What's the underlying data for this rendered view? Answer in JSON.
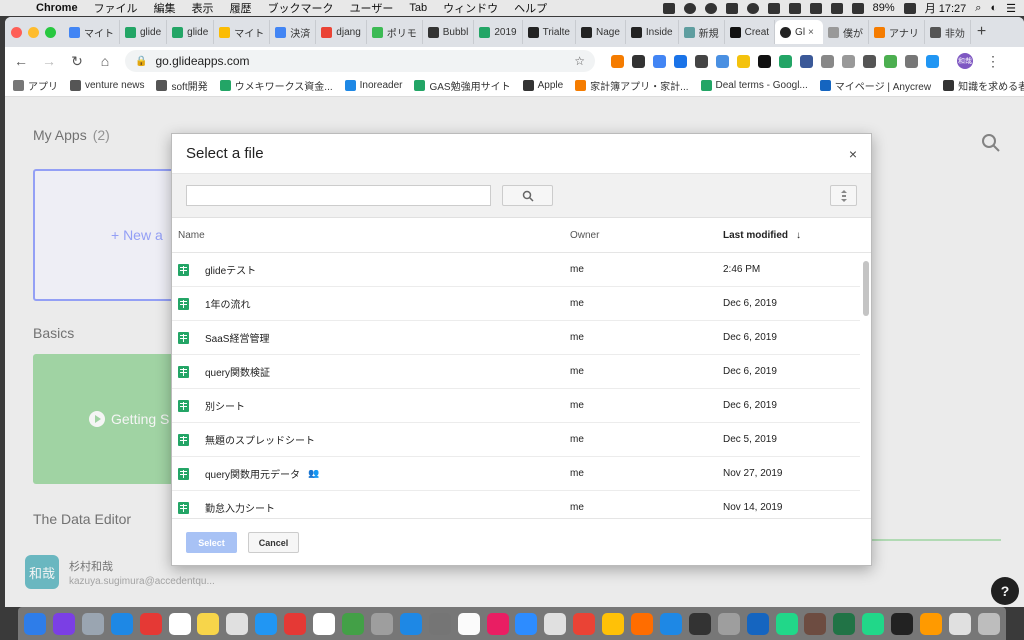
{
  "menubar": {
    "app_name": "Chrome",
    "items": [
      "ファイル",
      "編集",
      "表示",
      "履歴",
      "ブックマーク",
      "ユーザー",
      "Tab",
      "ウィンドウ",
      "ヘルプ"
    ],
    "battery": "89%",
    "clock": "月 17:27"
  },
  "tabs": [
    {
      "label": "マイト",
      "color": "#4285f4"
    },
    {
      "label": "glide",
      "color": "#23a566"
    },
    {
      "label": "glide",
      "color": "#23a566"
    },
    {
      "label": "マイト",
      "color": "#fbbc04"
    },
    {
      "label": "決済",
      "color": "#4285f4"
    },
    {
      "label": "djang",
      "color": "#ea4335"
    },
    {
      "label": "ポリモ",
      "color": "#3cba54"
    },
    {
      "label": "Bubbl",
      "color": "#333333"
    },
    {
      "label": "2019",
      "color": "#23a566"
    },
    {
      "label": "Trialte",
      "color": "#222222"
    },
    {
      "label": "Nage",
      "color": "#222222"
    },
    {
      "label": "Inside",
      "color": "#222222"
    },
    {
      "label": "新規",
      "color": "#5f9ea0"
    },
    {
      "label": "Creat",
      "color": "#111111"
    }
  ],
  "active_tab": {
    "label": "Gl",
    "close": "×"
  },
  "tabs_after": [
    {
      "label": "僕が",
      "color": "#999999"
    },
    {
      "label": "アナリ",
      "color": "#f57c00"
    },
    {
      "label": "非効",
      "color": "#555555"
    }
  ],
  "new_tab_label": "+",
  "address": {
    "url": "go.glideapps.com"
  },
  "profile_initials": "和哉",
  "extensions": [
    "#f57c00",
    "#333333",
    "#4285f4",
    "#1a73e8",
    "#444444",
    "#4a90e2",
    "#f4c20d",
    "#111111",
    "#23a566",
    "#3b5998",
    "#888888",
    "#999999",
    "#555555",
    "#4caf50",
    "#777777",
    "#2196f3"
  ],
  "bookmarks": [
    {
      "label": "アプリ",
      "color": "#777777"
    },
    {
      "label": "venture news",
      "color": "#555555"
    },
    {
      "label": "soft開発",
      "color": "#555555"
    },
    {
      "label": "ウメキワークス資金...",
      "color": "#23a566"
    },
    {
      "label": "Inoreader",
      "color": "#1e88e5"
    },
    {
      "label": "GAS勉強用サイト",
      "color": "#23a566"
    },
    {
      "label": "Apple",
      "color": "#333333"
    },
    {
      "label": "家計簿アプリ・家計...",
      "color": "#f57c00"
    },
    {
      "label": "Deal terms - Googl...",
      "color": "#23a566"
    },
    {
      "label": "マイページ | Anycrew",
      "color": "#1565c0"
    },
    {
      "label": "知識を求める者",
      "color": "#333333"
    }
  ],
  "bookmarks_more": "»",
  "page": {
    "my_apps_label": "My Apps",
    "my_apps_count": "(2)",
    "new_app_label": "+ New a",
    "basics_label": "Basics",
    "getting_started_label": "Getting S",
    "data_editor_label": "The Data Editor",
    "user_avatar": "和哉",
    "user_name": "杉村和哉",
    "user_email": "kazuya.sugimura@accedentqu...",
    "help_label": "?"
  },
  "dialog": {
    "title": "Select a file",
    "close": "×",
    "search_placeholder": "",
    "columns": {
      "name": "Name",
      "owner": "Owner",
      "modified": "Last modified",
      "sort_arrow": "↓"
    },
    "files": [
      {
        "name": "glideテスト",
        "owner": "me",
        "modified": "2:46 PM",
        "shared": false
      },
      {
        "name": "1年の流れ",
        "owner": "me",
        "modified": "Dec 6, 2019",
        "shared": false
      },
      {
        "name": "SaaS経営管理",
        "owner": "me",
        "modified": "Dec 6, 2019",
        "shared": false
      },
      {
        "name": "query関数検証",
        "owner": "me",
        "modified": "Dec 6, 2019",
        "shared": false
      },
      {
        "name": "別シート",
        "owner": "me",
        "modified": "Dec 6, 2019",
        "shared": false
      },
      {
        "name": "無題のスプレッドシート",
        "owner": "me",
        "modified": "Dec 5, 2019",
        "shared": false
      },
      {
        "name": "query関数用元データ",
        "owner": "me",
        "modified": "Nov 27, 2019",
        "shared": true
      },
      {
        "name": "勤怠入力シート",
        "owner": "me",
        "modified": "Nov 14, 2019",
        "shared": false
      }
    ],
    "select_label": "Select",
    "cancel_label": "Cancel"
  },
  "dock_apps": [
    "#2e7de9",
    "#7b3fe4",
    "#9aa5b1",
    "#1e88e5",
    "#e53935",
    "#ffffff",
    "#f7d54a",
    "#e0e0e0",
    "#2196f3",
    "#e53935",
    "#ffffff",
    "#43a047",
    "#9e9e9e",
    "#1e88e5",
    "#757575",
    "#fbfbfb",
    "#e91e63",
    "#2d8cff",
    "#e0e0e0",
    "#ea4335",
    "#ffc107",
    "#ff6d00",
    "#1e88e5",
    "#333333",
    "#9e9e9e",
    "#1565c0",
    "#21d789",
    "#6d4c41",
    "#217346",
    "#21d789",
    "#222222",
    "#ff9a00",
    "#e0e0e0",
    "#bdbdbd"
  ]
}
